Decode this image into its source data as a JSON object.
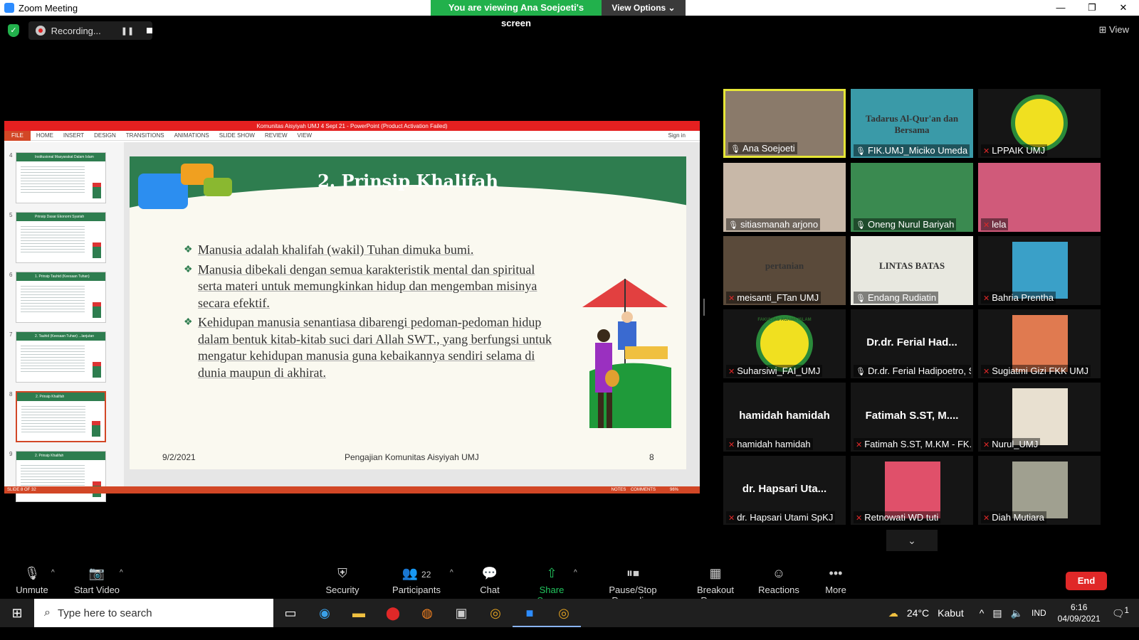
{
  "window": {
    "title": "Zoom Meeting",
    "viewing_banner": "You are viewing Ana Soejoeti's screen",
    "view_options": "View Options",
    "controls": [
      "—",
      "❐",
      "✕"
    ]
  },
  "recording": {
    "label": "Recording..."
  },
  "view_button": "View",
  "powerpoint": {
    "title": "Komunitas Aisyiyah UMJ 4 Sept 21 - PowerPoint (Product Activation Failed)",
    "tabs": [
      "FILE",
      "HOME",
      "INSERT",
      "DESIGN",
      "TRANSITIONS",
      "ANIMATIONS",
      "SLIDE SHOW",
      "REVIEW",
      "VIEW"
    ],
    "sign_in": "Sign in",
    "thumb_numbers": [
      "4",
      "5",
      "6",
      "7",
      "8",
      "9"
    ],
    "thumb_titles": [
      "Institusional Masyarakat Dalam Islam",
      "Prinsip Dasar Ekonomi Syariah",
      "1. Prinsip Tauhid (Keesaan Tuhan)",
      "2. Tauhid (Keesaan Tuhan) ...lanjutan",
      "2. Prinsip Khalifah",
      "2. Prinsip Khalifah"
    ],
    "status_left": "SLIDE 8 OF 32",
    "status_notes": "NOTES",
    "status_comments": "COMMENTS",
    "zoom_level": "96%"
  },
  "slide": {
    "title": "2. Prinsip Khalifah",
    "bullets": [
      "Manusia adalah khalifah (wakil) Tuhan dimuka bumi.",
      "Manusia dibekali dengan semua karakteristik mental dan spiritual serta materi untuk memungkinkan hidup dan mengemban misinya secara efektif.",
      "Kehidupan manusia senantiasa dibarengi pedoman-pedoman hidup dalam bentuk kitab-kitab suci dari Allah SWT., yang berfungsi untuk mengatur kehidupan manusia guna kebaikannya sendiri selama di dunia maupun di akhirat."
    ],
    "date": "9/2/2021",
    "footer": "Pengajian Komunitas Aisyiyah UMJ",
    "number": "8"
  },
  "participants": [
    {
      "name": "Ana Soejoeti",
      "muted": false,
      "active": true,
      "bg": "#8a7a6a"
    },
    {
      "name": "FIK.UMJ_Miciko Umeda",
      "muted": false,
      "bg": "#3a9aa8",
      "text": "Tadarus Al-Qur'an dan Bersama"
    },
    {
      "name": "LPPAIK UMJ",
      "muted": true,
      "bg": "#151515",
      "logo": true
    },
    {
      "name": "sitiasmanah arjono",
      "muted": false,
      "bg": "#c8b8a8"
    },
    {
      "name": "Oneng Nurul Bariyah",
      "muted": false,
      "bg": "#3a8a50"
    },
    {
      "name": "lela",
      "muted": true,
      "bg": "#d05a7a"
    },
    {
      "name": "meisanti_FTan UMJ",
      "muted": true,
      "bg": "#5a4a3a",
      "text": "pertanian"
    },
    {
      "name": "Endang Rudiatin",
      "muted": false,
      "bg": "#e8e8e0",
      "text": "LINTAS BATAS"
    },
    {
      "name": "Bahria Prentha",
      "muted": true,
      "bg": "#151515",
      "avatar": "#3aa0c8"
    },
    {
      "name": "Suharsiwi_FAI_UMJ",
      "muted": true,
      "bg": "#151515",
      "logo": true,
      "logo_text": "FAKULTAS AGAMA ISLAM"
    },
    {
      "name": "Dr.dr. Ferial Hadipoetro, S...",
      "muted": false,
      "bg": "#151515",
      "bigname": "Dr.dr. Ferial Had..."
    },
    {
      "name": "Sugiatmi Gizi FKK UMJ",
      "muted": true,
      "bg": "#151515",
      "avatar": "#e07a50"
    },
    {
      "name": "hamidah hamidah",
      "muted": true,
      "bg": "#151515",
      "bigname": "hamidah hamidah"
    },
    {
      "name": "Fatimah S.ST, M.KM - FK...",
      "muted": true,
      "bg": "#151515",
      "bigname": "Fatimah S.ST, M...."
    },
    {
      "name": "Nurul_UMJ",
      "muted": true,
      "bg": "#151515",
      "avatar": "#e8e0d0"
    },
    {
      "name": "dr. Hapsari Utami SpKJ",
      "muted": true,
      "bg": "#151515",
      "bigname": "dr. Hapsari Uta..."
    },
    {
      "name": "Retnowati WD tuti",
      "muted": true,
      "bg": "#151515",
      "avatar": "#e0506a"
    },
    {
      "name": "Diah Mutiara",
      "muted": true,
      "bg": "#151515",
      "avatar": "#a0a090"
    }
  ],
  "toolbar": {
    "unmute": "Unmute",
    "start_video": "Start Video",
    "security": "Security",
    "participants": "Participants",
    "participant_count": "22",
    "chat": "Chat",
    "share_screen": "Share Screen",
    "pause_stop": "Pause/Stop Recording",
    "breakout": "Breakout Rooms",
    "reactions": "Reactions",
    "more": "More",
    "end": "End"
  },
  "taskbar": {
    "search_placeholder": "Type here to search",
    "temperature": "24°C",
    "weather": "Kabut",
    "language": "IND",
    "time": "6:16",
    "date": "04/09/2021",
    "notifications": "1"
  }
}
